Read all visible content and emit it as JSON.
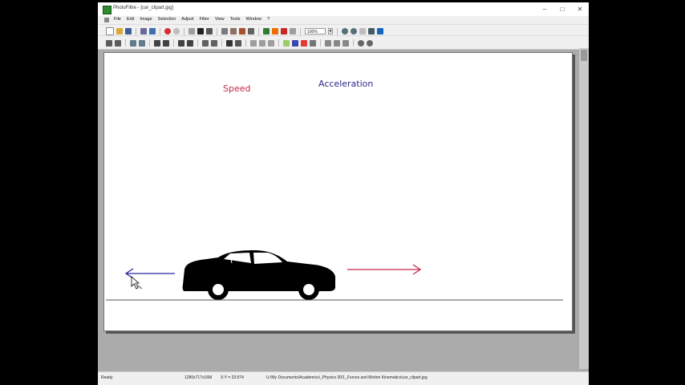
{
  "window": {
    "title": "PhotoFiltre - [car_clipart.jpg]"
  },
  "menu": [
    "File",
    "Edit",
    "Image",
    "Selection",
    "Adjust",
    "Filter",
    "View",
    "Tools",
    "Window",
    "?"
  ],
  "toolbar": {
    "zoom": "100%"
  },
  "canvas": {
    "labels": {
      "speed": "Speed",
      "acceleration": "Acceleration"
    },
    "colors": {
      "speed": "#c62848",
      "acceleration": "#2a2a8a",
      "left_arrow": "#2a2aa0",
      "right_arrow": "#c62848"
    }
  },
  "status": {
    "state": "Ready",
    "image_size": "1280x717x16M",
    "coords": "X:Y = 33:574",
    "path": "U:\\My Documents\\Academics\\_Physics 30\\1_Forces and Motion Kinematics\\car_clipart.jpg"
  }
}
